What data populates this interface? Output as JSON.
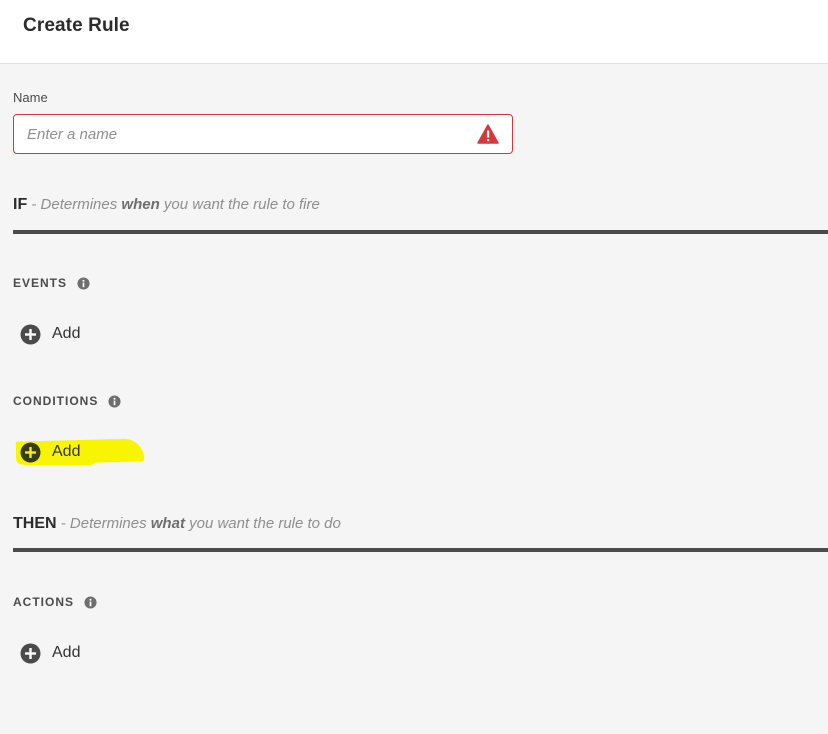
{
  "header": {
    "title": "Create Rule"
  },
  "name_field": {
    "label": "Name",
    "placeholder": "Enter a name",
    "value": "",
    "status_icon": "alert-triangle-icon",
    "error_color": "#d7373f"
  },
  "if_section": {
    "keyword": "IF",
    "desc_prefix": " - Determines ",
    "desc_bold": "when",
    "desc_suffix": " you want the rule to fire"
  },
  "events": {
    "heading": "EVENTS",
    "add_label": "Add"
  },
  "conditions": {
    "heading": "CONDITIONS",
    "add_label": "Add",
    "highlight_color": "#f7f500"
  },
  "then_section": {
    "keyword": "THEN",
    "desc_prefix": " - Determines ",
    "desc_bold": "what",
    "desc_suffix": " you want the rule to do"
  },
  "actions": {
    "heading": "ACTIONS",
    "add_label": "Add"
  },
  "icons": {
    "info": "info-icon",
    "add": "plus-circle-icon"
  }
}
